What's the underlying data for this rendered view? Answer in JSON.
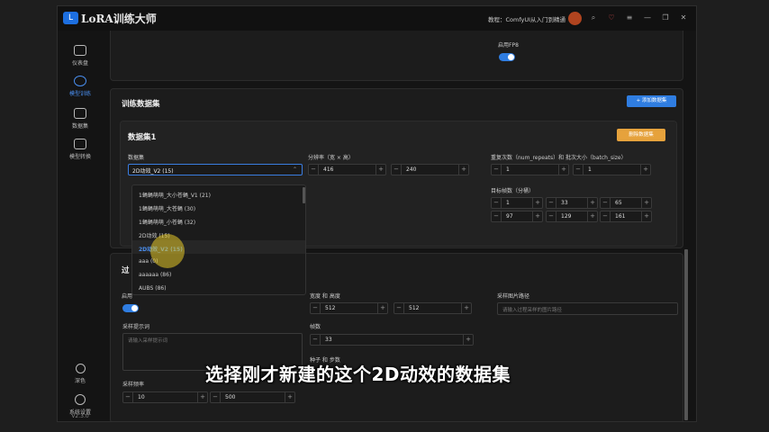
{
  "titlebar": {
    "logo": "L",
    "title": "LoRA训练大师",
    "tutorial": "教程：ComfyUI从入门到精通",
    "icons": [
      "search-icon",
      "heart-icon",
      "menu-icon",
      "minimize-icon",
      "restore-icon",
      "close-icon"
    ],
    "icon_glyphs": [
      "⌕",
      "♡",
      "≡",
      "—",
      "❐",
      "✕"
    ]
  },
  "sidebar": {
    "items": [
      {
        "label": "仪表盘",
        "icon": "dashboard-icon"
      },
      {
        "label": "模型训练",
        "icon": "training-icon",
        "active": true
      },
      {
        "label": "数据集",
        "icon": "dataset-icon"
      },
      {
        "label": "模型转换",
        "icon": "convert-icon"
      }
    ],
    "bottom": [
      {
        "label": "深色",
        "icon": "moon-icon"
      },
      {
        "label": "系统设置",
        "icon": "settings-icon"
      }
    ],
    "version": "V2.3.0"
  },
  "top_card": {
    "fp8_label": "启用FP8"
  },
  "dataset_section": {
    "title": "训练数据集",
    "add_button": "+ 添加数据集"
  },
  "dataset1": {
    "title": "数据集1",
    "delete_button": "删除数据集",
    "dataset_label": "数据集",
    "dataset_selected": "2D动效_V2 (15)",
    "resolution_label": "分辨率（宽 × 高）",
    "width": "416",
    "height": "240",
    "repeat_label": "重复次数（num_repeats）和 批次大小（batch_size）",
    "num_repeats": "1",
    "batch_size": "1",
    "frames_label": "目标帧数（分桶）",
    "frames": [
      "1",
      "33",
      "65",
      "97",
      "129",
      "161"
    ]
  },
  "dropdown": {
    "options": [
      "1蝇蝇萌萌_大小苍蝇_V1 (21)",
      "1蝇蝇萌萌_大苍蝇 (30)",
      "1蝇蝇萌萌_小苍蝇 (32)",
      "2D动效 (15)",
      "2D动效_V2 (15)",
      "aaa (0)",
      "aaaaaa (86)",
      "AUBS (86)"
    ],
    "selected_index": 4
  },
  "sample_section": {
    "title_partial": "过",
    "enable_partial": "启用",
    "size_label": "宽度 和 高度",
    "width": "512",
    "height": "512",
    "image_path_label": "采样图片路径",
    "image_path_placeholder": "请输入过程采样的图片路径",
    "prompt_label": "采样提示词",
    "prompt_placeholder": "请输入采样提示词",
    "frames_label": "帧数",
    "frames": "33",
    "seed_label": "种子 和 步数",
    "freq_label": "采样频率",
    "freq_a": "10",
    "freq_b": "500"
  },
  "subtitle": "选择刚才新建的这个2D动效的数据集"
}
